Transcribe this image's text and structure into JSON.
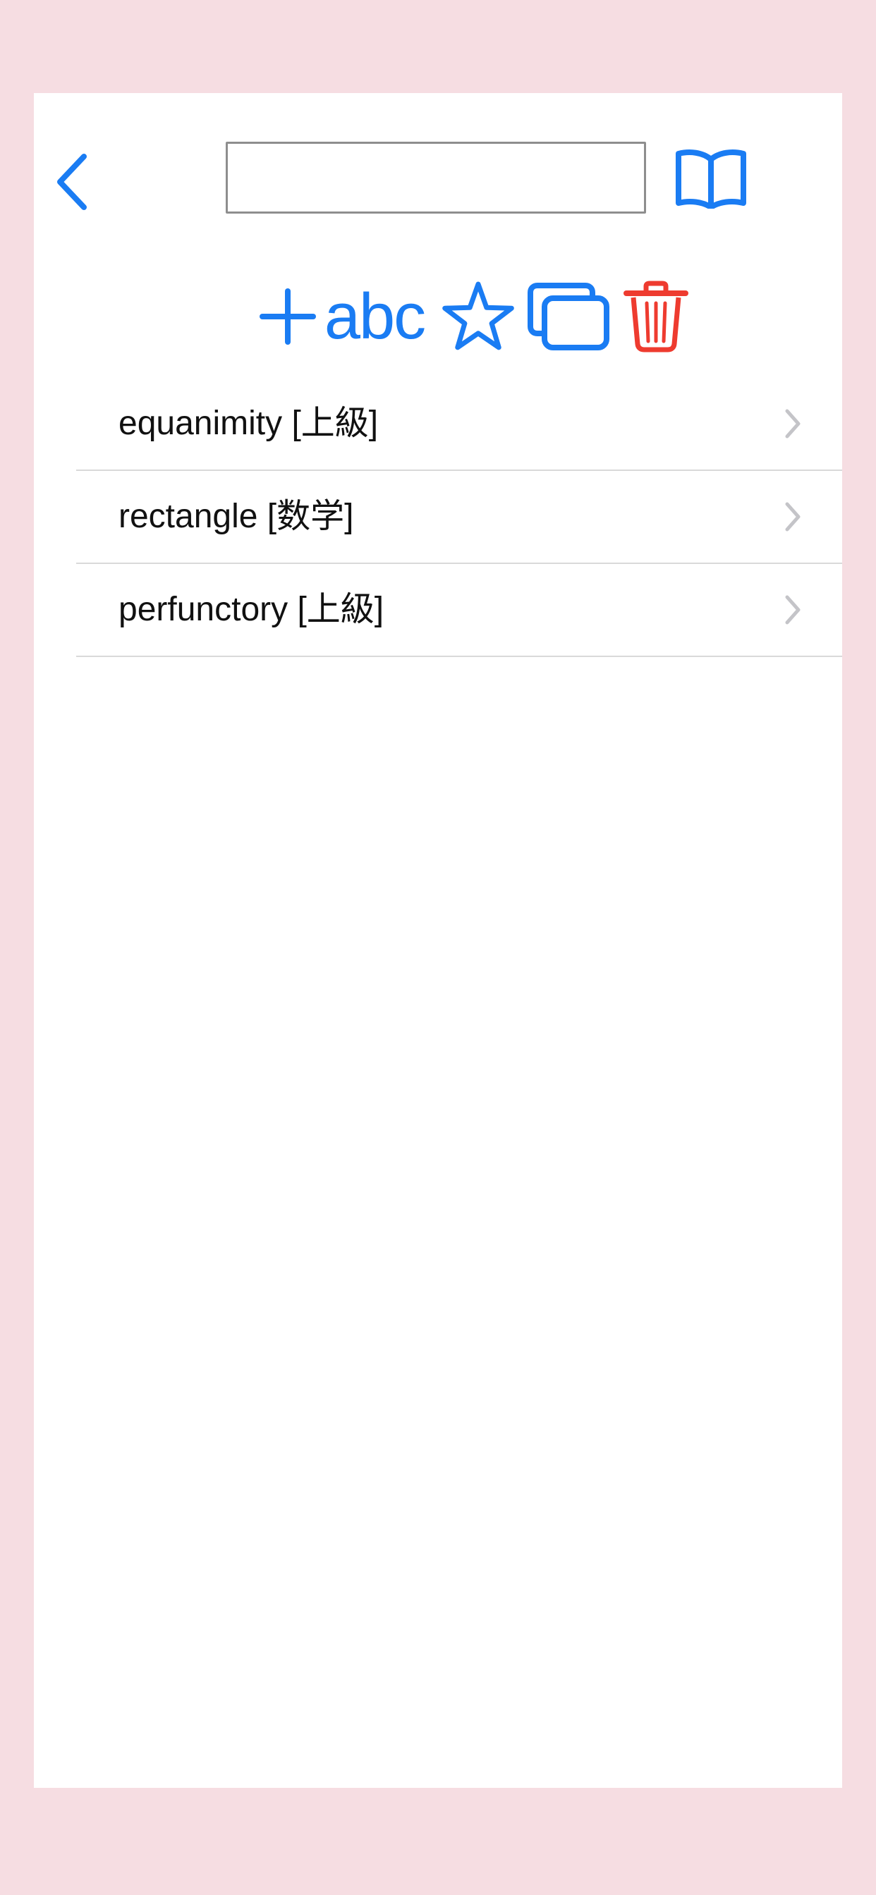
{
  "colors": {
    "background": "#f6dde2",
    "accent": "#1a7cf3",
    "destructive": "#ee3b2f",
    "separator": "#d9d9d9",
    "chevron": "#c4c4c8"
  },
  "header": {
    "back_icon": "chevron-left-icon",
    "search_value": "",
    "search_placeholder": "",
    "book_icon": "book-icon"
  },
  "toolbar": {
    "add_icon": "plus-icon",
    "abc_label": "abc",
    "star_icon": "star-icon",
    "copy_icon": "copy-icon",
    "trash_icon": "trash-icon"
  },
  "words": [
    {
      "label": "equanimity [上級]"
    },
    {
      "label": "rectangle [数学]"
    },
    {
      "label": "perfunctory [上級]"
    }
  ]
}
